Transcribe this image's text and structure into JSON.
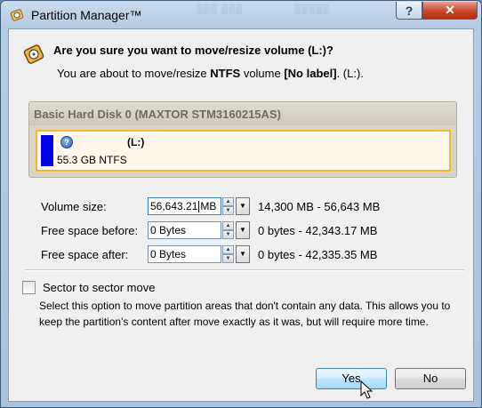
{
  "window": {
    "title": "Partition Manager™",
    "help_glyph": "?",
    "close_glyph": "✕"
  },
  "dialog": {
    "question": "Are you sure you want to move/resize volume (L:)?",
    "sub_prefix": "You are about to move/resize ",
    "sub_fs": "NTFS",
    "sub_middle": " volume ",
    "sub_label": "[No label]",
    "sub_suffix": ". (L:)."
  },
  "disk": {
    "name": "Basic Hard Disk 0 (MAXTOR STM3160215AS)",
    "partition": {
      "label": "(L:)",
      "size": "55.3 GB NTFS",
      "color": "#0000e6",
      "border_color": "#f1b635"
    }
  },
  "fields": [
    {
      "label": "Volume size:",
      "value_pre": "56,643.21",
      "value_post": "MB",
      "range": "14,300 MB - 56,643 MB"
    },
    {
      "label": "Free space before:",
      "value": "0 Bytes",
      "range": "0 bytes - 42,343.17 MB"
    },
    {
      "label": "Free space after:",
      "value": "0 Bytes",
      "range": "0 bytes - 42,335.35 MB"
    }
  ],
  "sector_move": {
    "checked": false,
    "label": "Sector to sector move",
    "description": "Select this option to move partition areas that don't contain any data. This allows you to keep the partition's content after move exactly as it was, but will require more time."
  },
  "buttons": {
    "yes": "Yes",
    "no": "No"
  }
}
